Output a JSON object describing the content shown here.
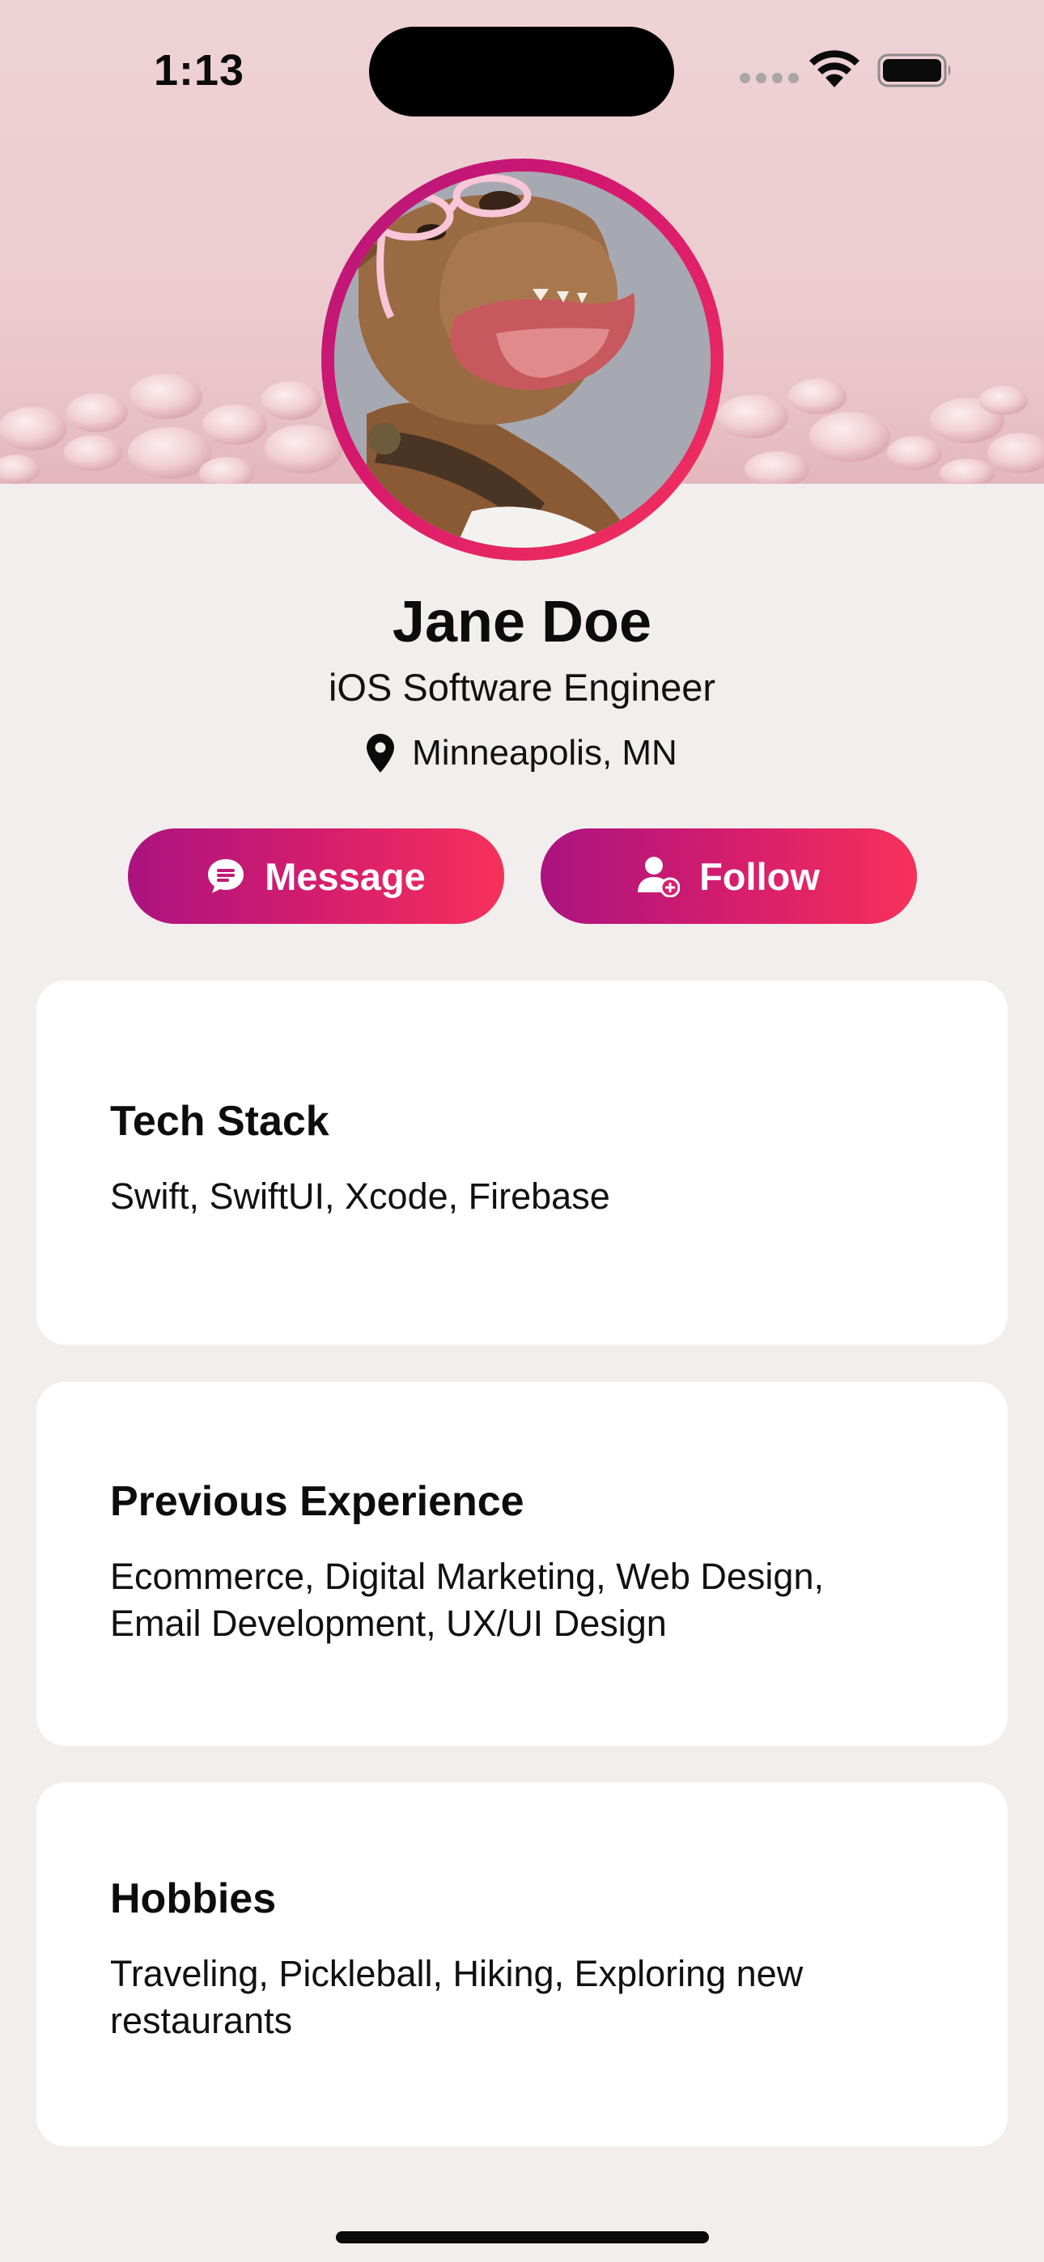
{
  "status_bar": {
    "time": "1:13"
  },
  "profile": {
    "name": "Jane Doe",
    "title": "iOS Software Engineer",
    "location": "Minneapolis, MN"
  },
  "actions": {
    "message_label": "Message",
    "follow_label": "Follow"
  },
  "cards": [
    {
      "title": "Tech Stack",
      "body": "Swift, SwiftUI, Xcode, Firebase"
    },
    {
      "title": "Previous Experience",
      "body": "Ecommerce, Digital Marketing, Web Design, Email Development, UX/UI Design"
    },
    {
      "title": "Hobbies",
      "body": "Traveling, Pickleball, Hiking, Exploring new restaurants"
    }
  ],
  "icons": {
    "location": "map-pin-icon",
    "message": "chat-bubble-icon",
    "follow": "add-person-icon"
  },
  "colors": {
    "accent_start": "#ab1380",
    "accent_end": "#f6315a",
    "background": "#f2eeee",
    "banner": "#efd2d5"
  }
}
